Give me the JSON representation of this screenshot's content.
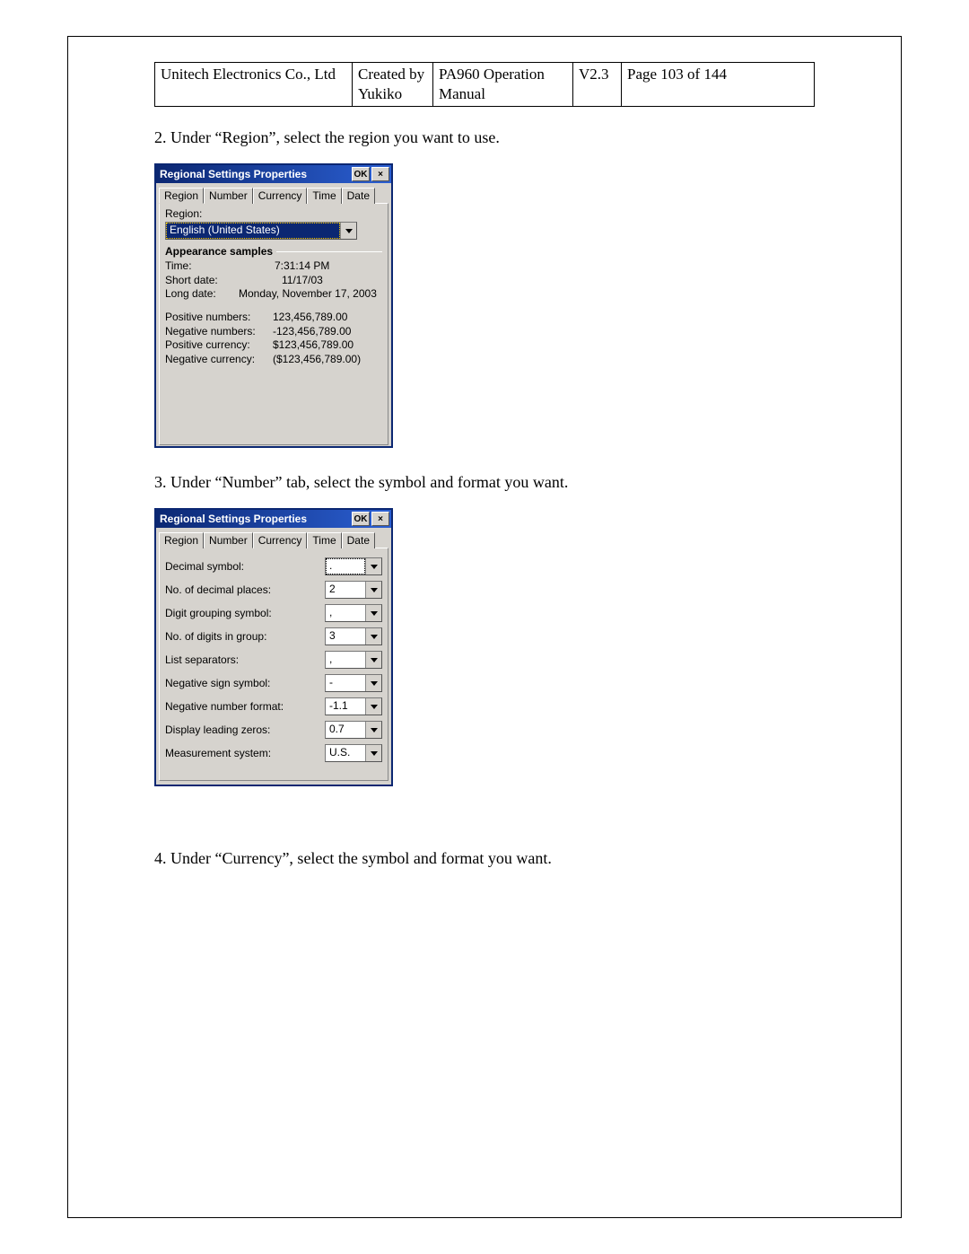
{
  "header": {
    "company": "Unitech Electronics Co., Ltd",
    "created_by": "Created by Yukiko",
    "doc": "PA960 Operation Manual",
    "version": "V2.3",
    "page": "Page 103 of 144"
  },
  "steps": {
    "s2": "2. Under “Region”, select the region you want to use.",
    "s3": "3. Under “Number” tab, select the symbol and format you want.",
    "s4": "4. Under “Currency”, select the symbol and format you want."
  },
  "dialog1": {
    "title": "Regional Settings Properties",
    "ok": "OK",
    "close": "×",
    "tabs": [
      "Region",
      "Number",
      "Currency",
      "Time",
      "Date"
    ],
    "region_label": "Region:",
    "region_value": "English (United States)",
    "appearance_label": "Appearance samples",
    "samples": {
      "time_lbl": "Time:",
      "time_val": "7:31:14 PM",
      "shortdate_lbl": "Short date:",
      "shortdate_val": "11/17/03",
      "longdate_lbl": "Long date:",
      "longdate_val": "Monday, November 17, 2003",
      "posnum_lbl": "Positive numbers:",
      "posnum_val": "123,456,789.00",
      "negnum_lbl": "Negative numbers:",
      "negnum_val": "-123,456,789.00",
      "poscur_lbl": "Positive currency:",
      "poscur_val": "$123,456,789.00",
      "negcur_lbl": "Negative currency:",
      "negcur_val": "($123,456,789.00)"
    }
  },
  "dialog2": {
    "title": "Regional Settings Properties",
    "ok": "OK",
    "close": "×",
    "tabs": [
      "Region",
      "Number",
      "Currency",
      "Time",
      "Date"
    ],
    "fields": {
      "decimal_symbol_lbl": "Decimal symbol:",
      "decimal_symbol_val": ".",
      "decimal_places_lbl": "No. of decimal places:",
      "decimal_places_val": "2",
      "grouping_symbol_lbl": "Digit grouping symbol:",
      "grouping_symbol_val": ",",
      "digits_group_lbl": "No. of digits in group:",
      "digits_group_val": "3",
      "list_sep_lbl": "List separators:",
      "list_sep_val": ",",
      "neg_sign_lbl": "Negative sign symbol:",
      "neg_sign_val": "-",
      "neg_format_lbl": "Negative number format:",
      "neg_format_val": "-1.1",
      "leading_zeros_lbl": "Display leading zeros:",
      "leading_zeros_val": "0.7",
      "measurement_lbl": "Measurement system:",
      "measurement_val": "U.S."
    }
  }
}
